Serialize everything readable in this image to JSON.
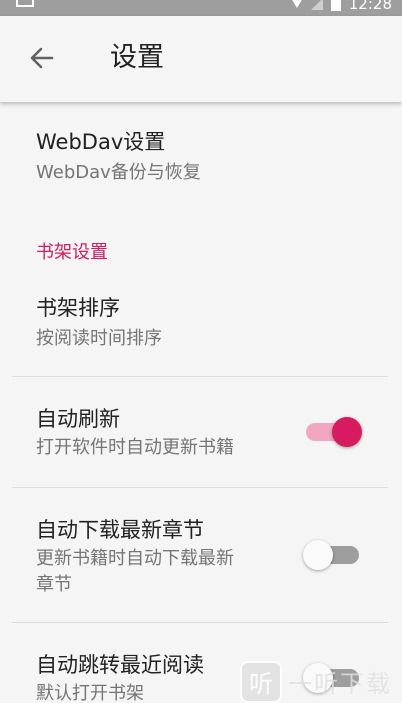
{
  "status_bar": {
    "time": "12:28"
  },
  "toolbar": {
    "title": "设置"
  },
  "prefs": {
    "webdav": {
      "title": "WebDav设置",
      "summary": "WebDav备份与恢复"
    },
    "bookshelf_category": "书架设置",
    "sort": {
      "title": "书架排序",
      "summary": "按阅读时间排序"
    },
    "auto_refresh": {
      "title": "自动刷新",
      "summary": "打开软件时自动更新书籍",
      "enabled": true
    },
    "auto_download": {
      "title": "自动下载最新章节",
      "summary_line1": "更新书籍时自动下载最新",
      "summary_line2": "章节",
      "enabled": false
    },
    "auto_jump": {
      "title": "自动跳转最近阅读",
      "summary": "默认打开书架",
      "enabled": false
    }
  },
  "colors": {
    "accent": "#d81b60",
    "accent_light": "#f1a6c1"
  },
  "watermark": {
    "logo": "听",
    "text": "一听下载"
  }
}
